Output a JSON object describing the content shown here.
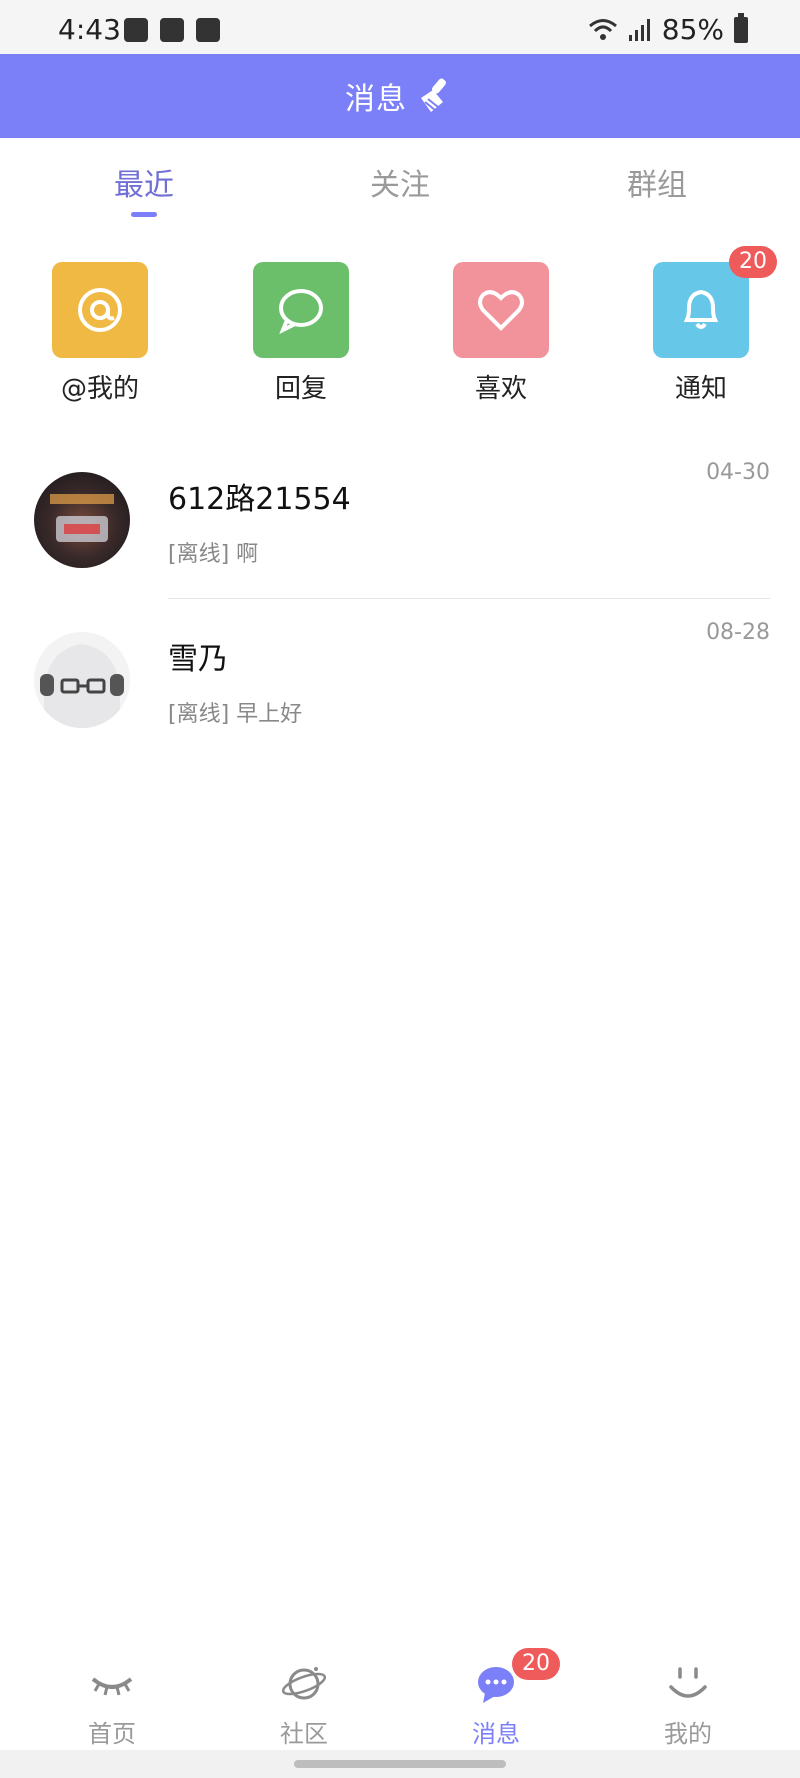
{
  "status_bar": {
    "time": "4:43",
    "battery": "85%"
  },
  "header": {
    "title": "消息",
    "accent": "#7b7ff8"
  },
  "tabs": [
    {
      "label": "最近",
      "active": true
    },
    {
      "label": "关注",
      "active": false
    },
    {
      "label": "群组",
      "active": false
    }
  ],
  "quick_actions": [
    {
      "label": "@我的",
      "icon": "at-icon",
      "color": "#f0b944"
    },
    {
      "label": "回复",
      "icon": "chat-bubble-icon",
      "color": "#6cbf6a"
    },
    {
      "label": "喜欢",
      "icon": "heart-icon",
      "color": "#f2939b"
    },
    {
      "label": "通知",
      "icon": "bell-icon",
      "color": "#66c7e8",
      "badge": "20"
    }
  ],
  "messages": [
    {
      "name": "612路21554",
      "preview": "[离线] 啊",
      "date": "04-30"
    },
    {
      "name": "雪乃",
      "preview": "[离线] 早上好",
      "date": "08-28"
    }
  ],
  "bottom_nav": [
    {
      "label": "首页",
      "icon": "eye-icon"
    },
    {
      "label": "社区",
      "icon": "planet-icon"
    },
    {
      "label": "消息",
      "icon": "message-bubble-icon",
      "badge": "20",
      "active": true
    },
    {
      "label": "我的",
      "icon": "smile-icon"
    }
  ]
}
